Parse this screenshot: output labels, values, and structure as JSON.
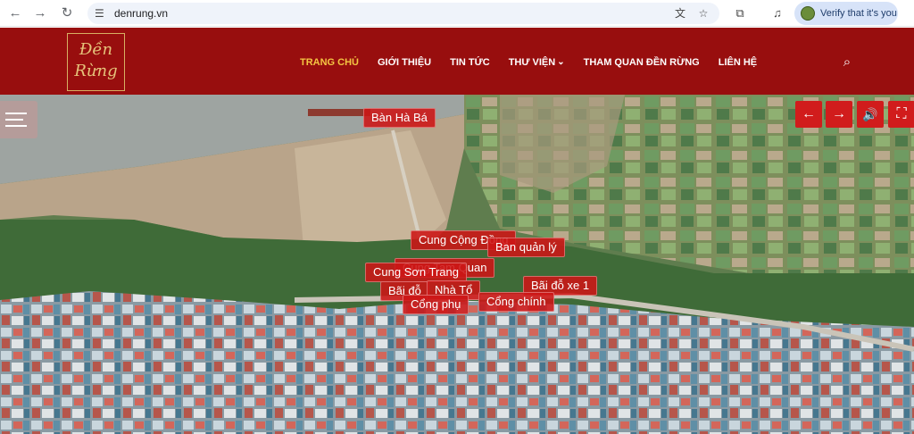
{
  "browser": {
    "url": "denrung.vn",
    "verify_label": "Verify that it's you",
    "icons": {
      "back": "←",
      "forward": "→",
      "reload": "↻",
      "site_info": "☰",
      "translate": "文",
      "bookmark": "☆",
      "extensions": "⧉",
      "media": "♫"
    }
  },
  "site": {
    "logo_line1": "Đền",
    "logo_line2": "Rừng",
    "menu": [
      {
        "label": "TRANG CHỦ"
      },
      {
        "label": "GIỚI THIỆU"
      },
      {
        "label": "TIN TỨC"
      },
      {
        "label": "THƯ VIỆN"
      },
      {
        "label": "THAM QUAN ĐỀN RỪNG"
      },
      {
        "label": "LIÊN HỆ"
      }
    ],
    "search_icon": "⌕",
    "dropdown_icon": "⌄"
  },
  "viewer": {
    "controls": {
      "prev": "←",
      "next": "→",
      "sound": "🔊",
      "fullscreen": "⛶"
    },
    "hotspots": [
      {
        "label": "Bàn Hà Bá"
      },
      {
        "label": "Cung Cộng Đồng"
      },
      {
        "label": "Ban quản lý"
      },
      {
        "label": "Cung Sơn Trang"
      },
      {
        "label": "Cung Tam Quan"
      },
      {
        "label": "Bãi đỗ xe 1"
      },
      {
        "label": "Bãi đỗ"
      },
      {
        "label": "Nhà Tổ"
      },
      {
        "label": "Cổng phụ"
      },
      {
        "label": "Cổng chính"
      }
    ]
  },
  "colors": {
    "header_bg": "#980e0e",
    "menu_active": "#f4c543",
    "hotspot_bg": "#cd1616",
    "control_bg": "#d11c1c"
  }
}
